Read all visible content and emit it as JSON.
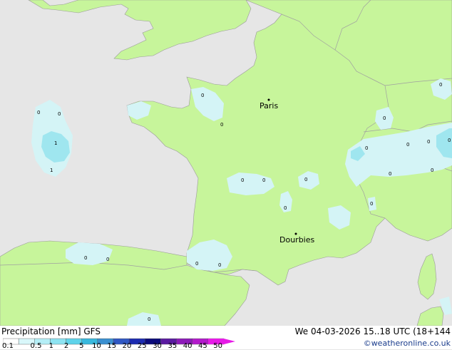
{
  "map": {
    "cities": [
      {
        "name": "Paris"
      },
      {
        "name": "Dourbies"
      }
    ],
    "precip_values": [
      "0",
      "0",
      "1",
      "1",
      "0",
      "0",
      "0",
      "0",
      "0",
      "0",
      "0",
      "0",
      "0",
      "0",
      "0",
      "0",
      "0",
      "0",
      "0",
      "0",
      "0",
      "0",
      "0",
      "0"
    ]
  },
  "footer": {
    "title": "Precipitation [mm] GFS",
    "datetime": "We 04-03-2026 15..18 UTC (18+144",
    "credit": "©weatheronline.co.uk"
  },
  "legend": {
    "ticks": [
      "0.1",
      "0.5",
      "1",
      "2",
      "5",
      "10",
      "15",
      "20",
      "25",
      "30",
      "35",
      "40",
      "45",
      "50"
    ],
    "colors": [
      "#ffffff",
      "#d9f7fa",
      "#b4eef6",
      "#8de3f1",
      "#5fd3ea",
      "#38b8dd",
      "#3a8fd0",
      "#2f57c3",
      "#1c2bb0",
      "#0a0a7a",
      "#5a1aa0",
      "#8c1ab8",
      "#b31acb",
      "#d21ad6",
      "#e61ae6"
    ]
  },
  "colors": {
    "land": "#c7f59b",
    "sea": "#e6e6e6",
    "precip_light": "#d4f4f6",
    "precip_mid": "#9fe6ef",
    "border": "#a0a0a0"
  }
}
